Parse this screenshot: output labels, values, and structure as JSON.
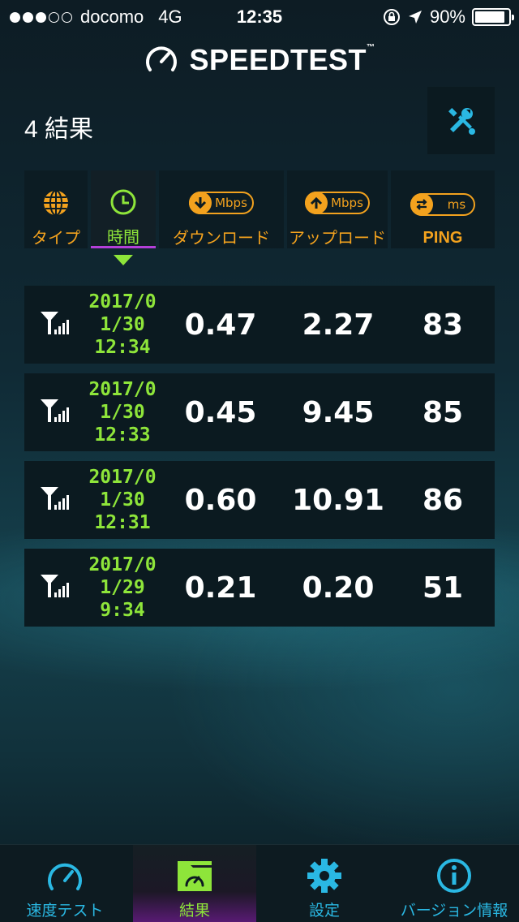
{
  "status_bar": {
    "carrier": "docomo",
    "network": "4G",
    "time": "12:35",
    "battery": "90%",
    "signal_dots_on": 3,
    "signal_dots_total": 5
  },
  "app": {
    "logo": "SPEEDTEST",
    "tm": "™"
  },
  "header": {
    "results_count": "4 結果",
    "tools_icon": "wrench-screwdriver-icon"
  },
  "columns": {
    "type": "タイプ",
    "time": "時間",
    "download": "ダウンロード",
    "download_unit": "Mbps",
    "upload": "アップロード",
    "upload_unit": "Mbps",
    "ping": "PING",
    "ping_unit": "ms",
    "active": "time"
  },
  "results": [
    {
      "date1": "2017/0",
      "date2": "1/30",
      "time": "12:34",
      "download": "0.47",
      "upload": "2.27",
      "ping": "83"
    },
    {
      "date1": "2017/0",
      "date2": "1/30",
      "time": "12:33",
      "download": "0.45",
      "upload": "9.45",
      "ping": "85"
    },
    {
      "date1": "2017/0",
      "date2": "1/30",
      "time": "12:31",
      "download": "0.60",
      "upload": "10.91",
      "ping": "86"
    },
    {
      "date1": "2017/0",
      "date2": "1/29",
      "time": "9:34",
      "download": "0.21",
      "upload": "0.20",
      "ping": "51"
    }
  ],
  "tabs": [
    {
      "label": "速度テスト",
      "icon": "speedometer-icon"
    },
    {
      "label": "結果",
      "icon": "results-folder-icon",
      "active": true
    },
    {
      "label": "設定",
      "icon": "gear-icon"
    },
    {
      "label": "バージョン情報",
      "icon": "info-icon"
    }
  ],
  "colors": {
    "accent_orange": "#f3a21e",
    "accent_green": "#8ee53a",
    "accent_blue": "#2ab8e3",
    "accent_purple": "#b43fd8"
  }
}
